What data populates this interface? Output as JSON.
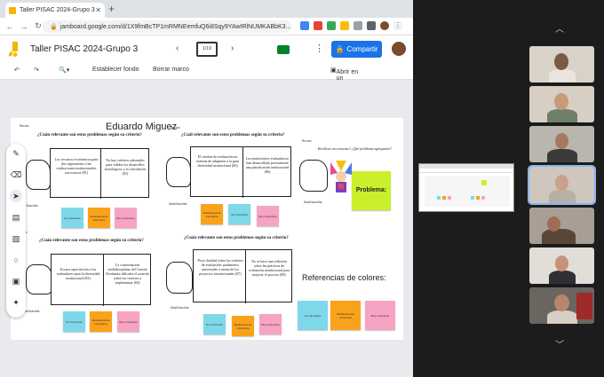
{
  "browser": {
    "tab_title": "Taller PISAC 2024-Grupo 3",
    "url": "jamboard.google.com/d/1X9fmBcTP1mRMNEemfuQ6i8Sqy9YAwIRlNUMKABbK3..."
  },
  "jamboard": {
    "title": "Taller PISAC 2024-Grupo 3",
    "frame_indicator": "1/19",
    "share_label": "Compartir",
    "toolbar": {
      "set_background": "Establecer fondo",
      "clear_frame": "Borrar marco",
      "open_in_jamboard": "Abrir en un Jamboard"
    }
  },
  "board": {
    "author": "Eduardo Miguez",
    "sector_label": "Sector:",
    "justified_label": "Justificación:",
    "question": "¿Cuán relevante son estos problemas según su criterio?",
    "question_alt": "¿Cuál relevante son estos problemas según su criterio?",
    "question_alt2": "¿Cuán relevante son estos problemas según su criterio?",
    "problem_prompt": "Recibiste un consenso! ¿Qué problema agregarías?",
    "problem_label": "Problema:",
    "colors_title": "Referencias de colores:",
    "panels": [
      {
        "text": "Los recursos económicos para dar seguimiento a las evaluaciones institucionales son escasos (81)"
      },
      {
        "text": "No hay criterios adecuados para validar los desarrollos tecnológicos y la vinculación (82)"
      },
      {
        "text": "El sistema de evaluación no termina de adaptarse a la gran diversidad institucional (83)"
      },
      {
        "text": "Las instituciones evaluadas no han desarrollado previamente una planificación institucional (86)"
      },
      {
        "text": "Escasa capacitación a los evaluadores para la diversidad institucional (83)"
      },
      {
        "text": "La conformación multidisciplinar del Comité Evaluador dificulta el acuerdo sobre los criterios a implementar (84)"
      },
      {
        "text": "Poca claridad sobre los criterios de evaluación: parámetros universales o metas de los proyectos institucionales (87)"
      },
      {
        "text": "No se hace una reflexión sobre las prácticas de evaluación institucional para mejorar el proceso (88)"
      }
    ],
    "stickies": {
      "not_important": "No importante",
      "medium": "Medianamente importante",
      "very": "Muy importante"
    },
    "colors": {
      "not_important": "#7fd8ea",
      "medium": "#f9a31a",
      "very": "#f7a3c4",
      "problem": "#c9f02a"
    }
  },
  "meet": {
    "shared_preview_label": "Jamboard"
  }
}
